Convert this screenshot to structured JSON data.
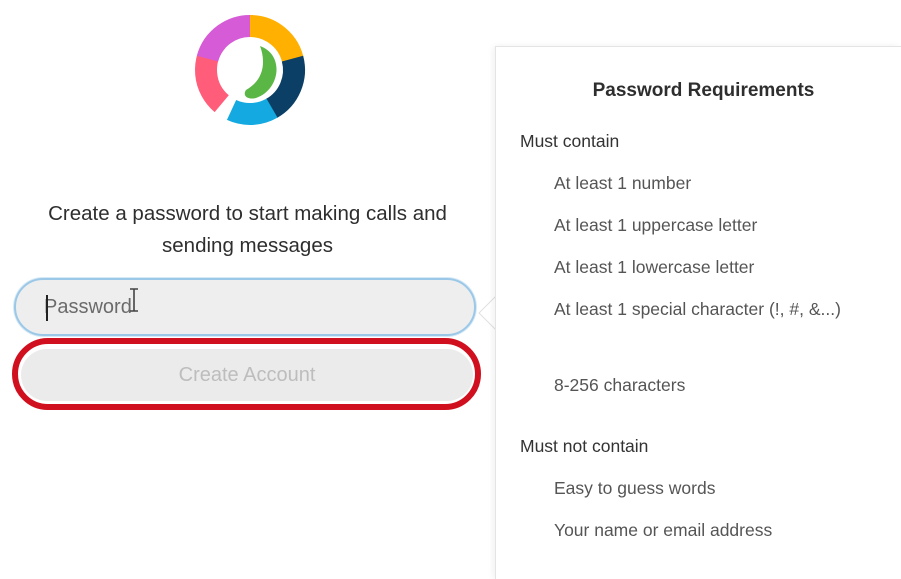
{
  "signup": {
    "heading": "Create a password to start making calls and sending messages",
    "password_placeholder": "Password",
    "create_account_label": "Create Account"
  },
  "requirements": {
    "title": "Password Requirements",
    "must_contain_label": "Must contain",
    "must_contain": [
      "At least 1 number",
      "At least 1 uppercase letter",
      "At least 1 lowercase letter",
      "At least 1 special character (!, #, &...)",
      "8-256 characters"
    ],
    "must_not_contain_label": "Must not contain",
    "must_not_contain": [
      "Easy to guess words",
      "Your name or email address"
    ]
  },
  "colors": {
    "annotation_ring": "#d0101e",
    "input_focus_border": "#9cc8e8",
    "button_disabled_bg": "#ebebeb",
    "button_disabled_text": "#bdbdbd"
  },
  "icons": {
    "logo": "webex-logo",
    "cursor": "text-cursor-icon"
  }
}
